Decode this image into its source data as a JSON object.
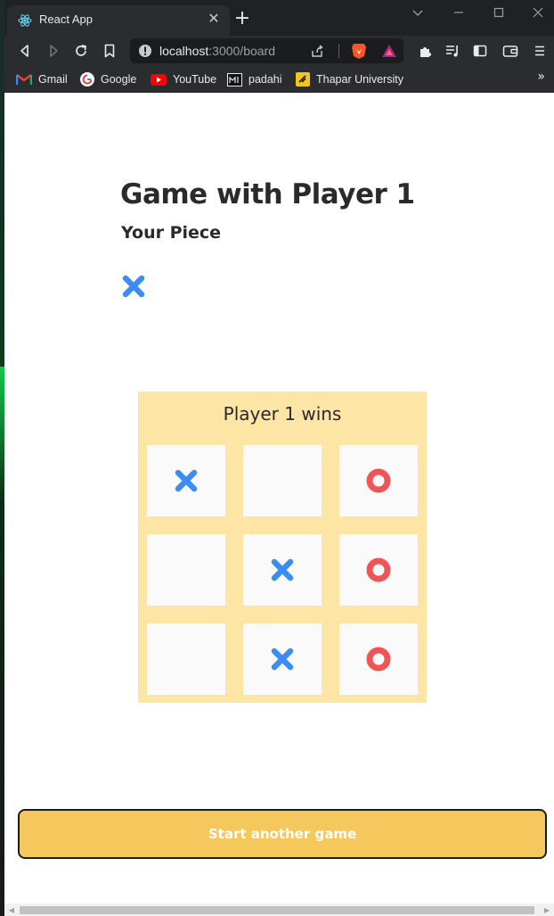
{
  "browser": {
    "tab_title": "React App",
    "tab_favicon": "react-icon",
    "url_host": "localhost",
    "url_path": ":3000/board",
    "bookmarks": [
      {
        "label": "Gmail",
        "icon": "gmail-icon"
      },
      {
        "label": "Google",
        "icon": "google-icon"
      },
      {
        "label": "YouTube",
        "icon": "youtube-icon"
      },
      {
        "label": "padahi",
        "icon": "padahi-icon"
      },
      {
        "label": "Thapar University",
        "icon": "thapar-icon"
      }
    ],
    "overflow_icon": "double-chevron-right-icon"
  },
  "game": {
    "title": "Game with Player 1",
    "piece_label": "Your Piece",
    "my_piece": "X",
    "status": "Player 1 wins",
    "board": [
      [
        "X",
        "",
        "O"
      ],
      [
        "",
        "X",
        "O"
      ],
      [
        "",
        "X",
        "O"
      ]
    ],
    "colors": {
      "x": "#3b8cf5",
      "o": "#f05454",
      "board_bg": "#fde5a5",
      "cell_bg": "#fafafa",
      "button_bg": "#f5c85e"
    },
    "restart_label": "Start another game"
  }
}
